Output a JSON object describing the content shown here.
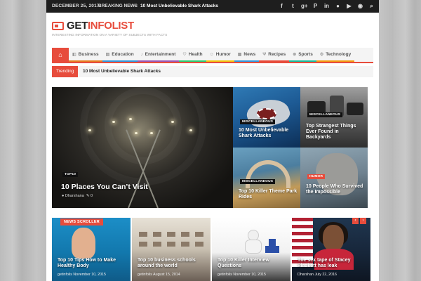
{
  "topbar": {
    "date": "DECEMBER 25, 2017",
    "breaking_label": "BREAKING NEWS",
    "breaking_headline": "10 Most Unbelievable Shark Attacks",
    "social_icons": [
      "facebook-icon",
      "twitter-icon",
      "google-plus-icon",
      "pinterest-icon",
      "linkedin-icon",
      "flickr-icon",
      "youtube-icon",
      "rss-icon",
      "search-icon"
    ]
  },
  "logo": {
    "name_dark": "GET",
    "name_red": "INFOLIST",
    "tagline": "INTERESTING INFORMATION ON A VARIETY OF SUBJECTS WITH FACTS"
  },
  "nav": {
    "items": [
      {
        "label": "Business",
        "color": "#e67e22"
      },
      {
        "label": "Education",
        "color": "#3498db"
      },
      {
        "label": "Entertainment",
        "color": "#9b59b6"
      },
      {
        "label": "Health",
        "color": "#2ecc71"
      },
      {
        "label": "Humor",
        "color": "#f1c40f"
      },
      {
        "label": "News",
        "color": "#3498db"
      },
      {
        "label": "Recipes",
        "color": "#e74c3c"
      },
      {
        "label": "Sports",
        "color": "#1abc9c"
      },
      {
        "label": "Technology",
        "color": "#f39c12"
      }
    ],
    "accent": "#e74c3c"
  },
  "trending": {
    "label": "Trending",
    "headline": "10 Most Unbelievable Shark Attacks"
  },
  "featured": {
    "big": {
      "category": "TOP10",
      "title": "10 Places You Can’t Visit",
      "author": "Dharshana",
      "comments": "0"
    },
    "tiles": [
      {
        "category": "MISCELLANEOUS",
        "title": "10 Most Unbelievable Shark Attacks"
      },
      {
        "category": "MISCELLANEOUS",
        "title": "Top Strangest Things Ever Found in Backyards"
      },
      {
        "category": "MISCELLANEOUS",
        "title": "Top 10 Killer Theme Park Rides"
      },
      {
        "category": "HUMOR",
        "title": "10 People Who Survived the Impossible"
      }
    ]
  },
  "scroller": {
    "label": "NEWS SCROLLER",
    "prev": "‹",
    "next": "›",
    "items": [
      {
        "title": "Top 10 Tips How to Make Healthy Body",
        "author": "getinfolis",
        "date": "November 10, 2015"
      },
      {
        "title": "Top 10 business schools around the world",
        "author": "getinfolis",
        "date": "August 15, 2014"
      },
      {
        "title": "Top 10 Killer Interview Questions",
        "author": "getinfolis",
        "date": "November 10, 2015"
      },
      {
        "title": "The sex tape of Stacey Plaskett has leak",
        "author": "Dharshan",
        "date": "July 22, 2016"
      }
    ]
  }
}
